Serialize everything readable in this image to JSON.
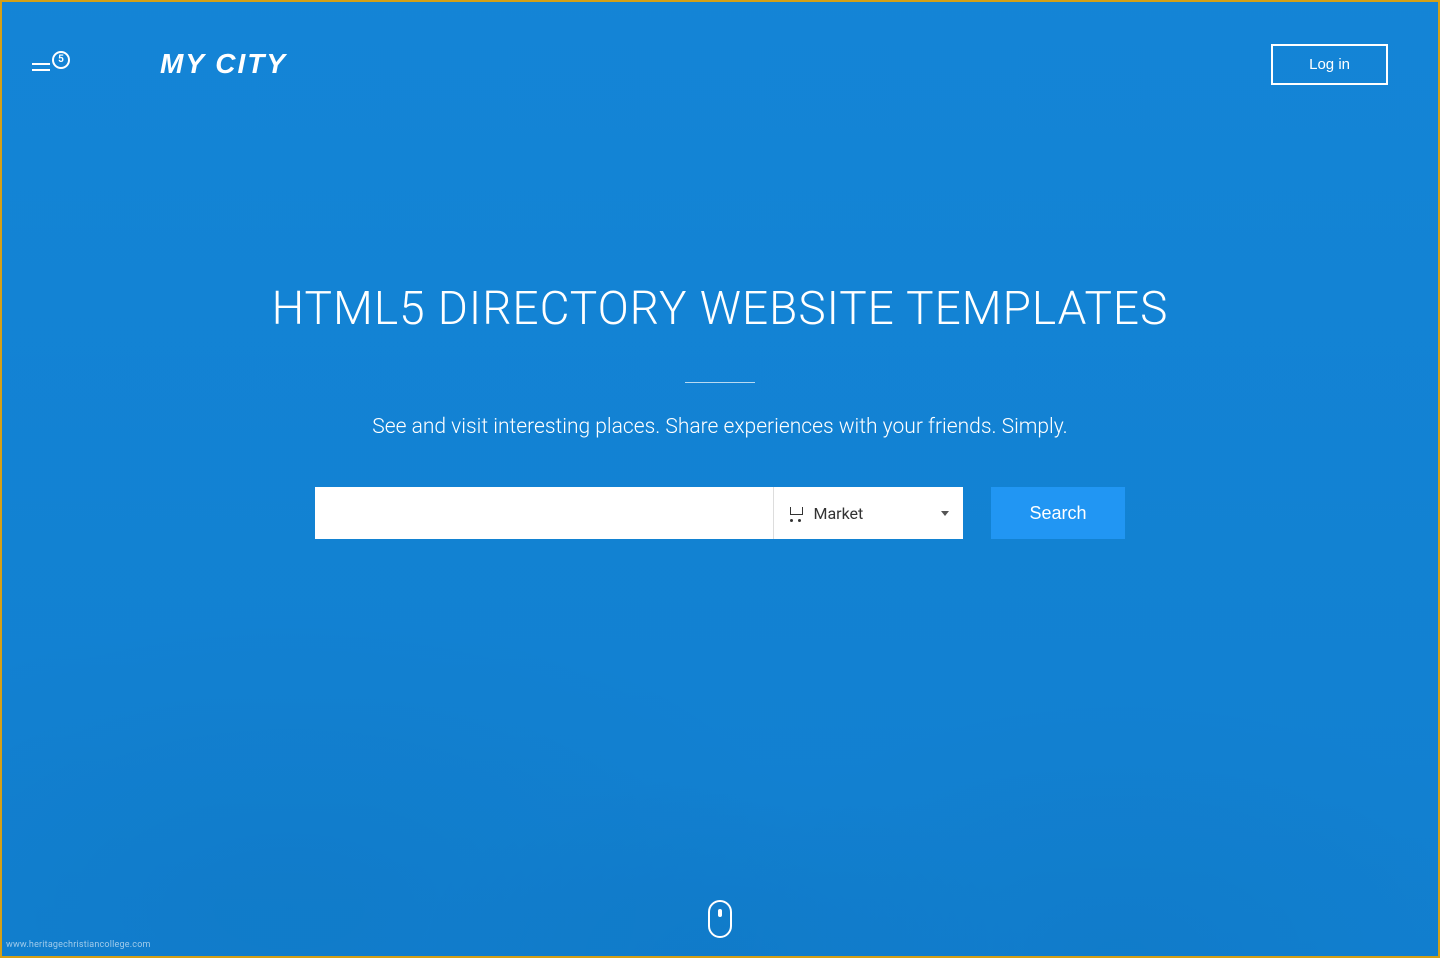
{
  "header": {
    "menu_badge_count": "5",
    "brand": "MY CITY",
    "login_label": "Log in"
  },
  "hero": {
    "headline": "HTML5 DIRECTORY WEBSITE TEMPLATES",
    "subhead": "See and visit interesting places. Share experiences with your friends. Simply."
  },
  "search": {
    "input_value": "",
    "input_placeholder": "",
    "category_selected": "Market",
    "button_label": "Search"
  },
  "footer": {
    "watermark": "www.heritagechristiancollege.com"
  },
  "colors": {
    "overlay": "#1284d6",
    "button_blue": "#2196f3",
    "border_gold": "#d4a017"
  }
}
